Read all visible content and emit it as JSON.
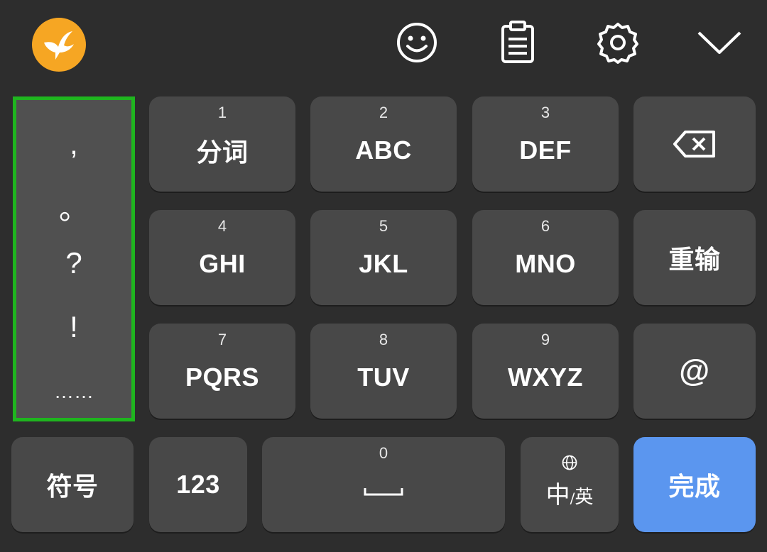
{
  "toolbar": {
    "logo": "hummingbird-logo",
    "icons": [
      "emoji-icon",
      "clipboard-icon",
      "settings-icon",
      "collapse-chevron-icon"
    ],
    "logo_color": "#f6a623"
  },
  "punctuation": [
    ",",
    "。",
    "?",
    "!",
    "……"
  ],
  "keys": {
    "k1": {
      "num": "1",
      "label": "分词"
    },
    "k2": {
      "num": "2",
      "label": "ABC"
    },
    "k3": {
      "num": "3",
      "label": "DEF"
    },
    "k4": {
      "num": "4",
      "label": "GHI"
    },
    "k5": {
      "num": "5",
      "label": "JKL"
    },
    "k6": {
      "num": "6",
      "label": "MNO"
    },
    "k7": {
      "num": "7",
      "label": "PQRS"
    },
    "k8": {
      "num": "8",
      "label": "TUV"
    },
    "k9": {
      "num": "9",
      "label": "WXYZ"
    },
    "reinput": "重输",
    "at": "@",
    "symbols": "符号",
    "numbers": "123",
    "space_num": "0",
    "lang_main": "中",
    "lang_sep": "/",
    "lang_alt": "英",
    "done": "完成"
  },
  "colors": {
    "background": "#2d2d2d",
    "key": "#484848",
    "done": "#5b96ef",
    "highlight_border": "#1fb51f"
  }
}
